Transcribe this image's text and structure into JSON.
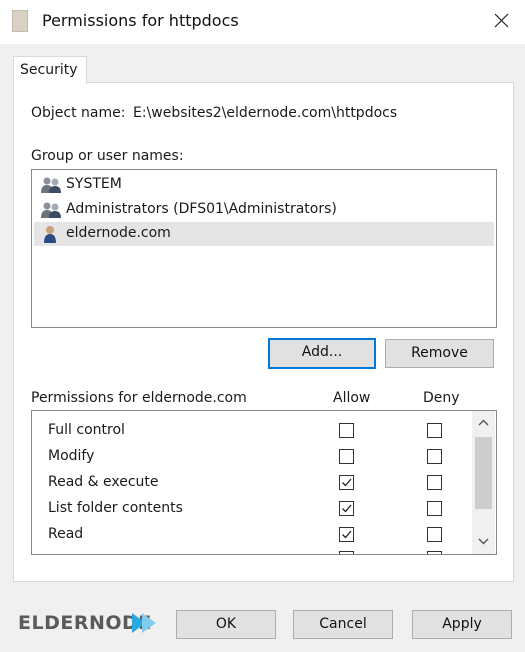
{
  "window": {
    "title": "Permissions for httpdocs"
  },
  "tabs": [
    {
      "label": "Security"
    }
  ],
  "object_name": {
    "label": "Object name:",
    "value": "E:\\websites2\\eldernode.com\\httpdocs"
  },
  "groups": {
    "label": "Group or user names:",
    "items": [
      {
        "label": "SYSTEM",
        "icon": "group-icon"
      },
      {
        "label": "Administrators (DFS01\\Administrators)",
        "icon": "group-icon"
      },
      {
        "label": "eldernode.com",
        "icon": "user-icon",
        "selected": true
      }
    ]
  },
  "buttons": {
    "add": "Add...",
    "remove": "Remove",
    "ok": "OK",
    "cancel": "Cancel",
    "apply": "Apply"
  },
  "permissions": {
    "label": "Permissions for eldernode.com",
    "allow_header": "Allow",
    "deny_header": "Deny",
    "rows": [
      {
        "name": "Full control",
        "allow": false,
        "deny": false
      },
      {
        "name": "Modify",
        "allow": false,
        "deny": false
      },
      {
        "name": "Read & execute",
        "allow": true,
        "deny": false
      },
      {
        "name": "List folder contents",
        "allow": true,
        "deny": false
      },
      {
        "name": "Read",
        "allow": true,
        "deny": false
      }
    ]
  },
  "branding": {
    "logo_text": "ELDERNODE"
  },
  "colors": {
    "accent": "#0078d7",
    "logo_arrow": "#29a9e1"
  }
}
